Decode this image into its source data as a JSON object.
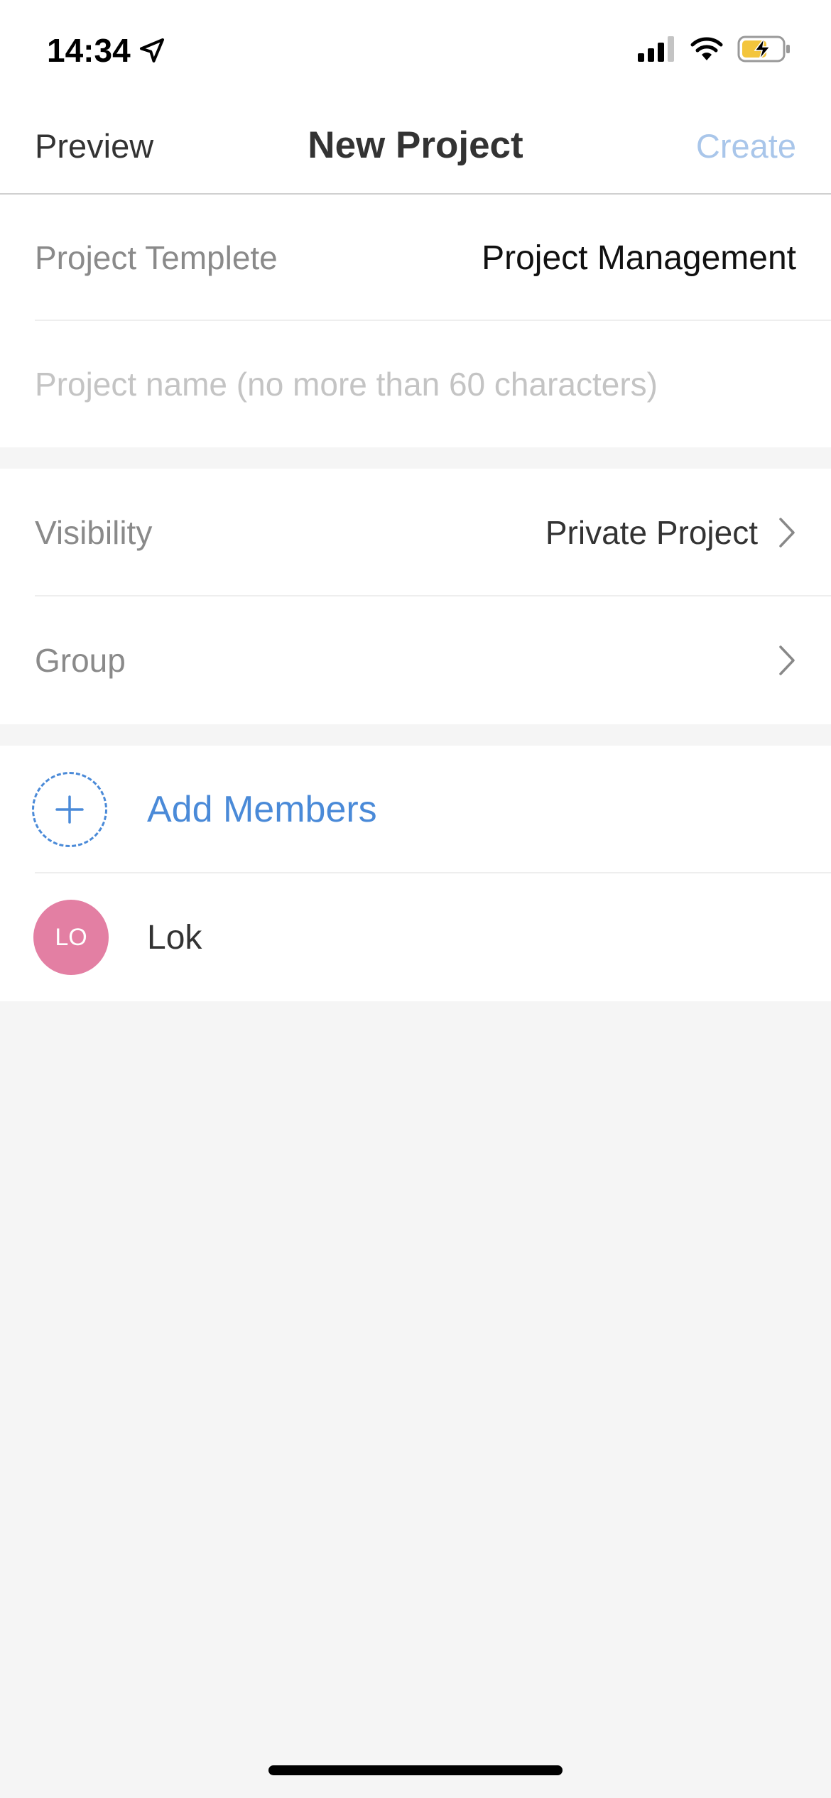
{
  "status_bar": {
    "time": "14:34",
    "icons": [
      "location-arrow-icon",
      "signal-icon",
      "wifi-icon",
      "battery-charging-icon"
    ]
  },
  "nav": {
    "left_label": "Preview",
    "title": "New Project",
    "right_label": "Create"
  },
  "project": {
    "template_label": "Project Templete",
    "template_value": "Project Management",
    "name_placeholder": "Project name (no more than 60 characters)"
  },
  "settings": {
    "visibility_label": "Visibility",
    "visibility_value": "Private Project",
    "group_label": "Group",
    "group_value": ""
  },
  "members": {
    "add_label": "Add Members",
    "list": [
      {
        "initials": "LO",
        "name": "Lok"
      }
    ]
  },
  "colors": {
    "accent": "#4a8ad8",
    "create_disabled": "#a9c6ea",
    "avatar": "#e37fa3",
    "background": "#f5f5f5"
  }
}
